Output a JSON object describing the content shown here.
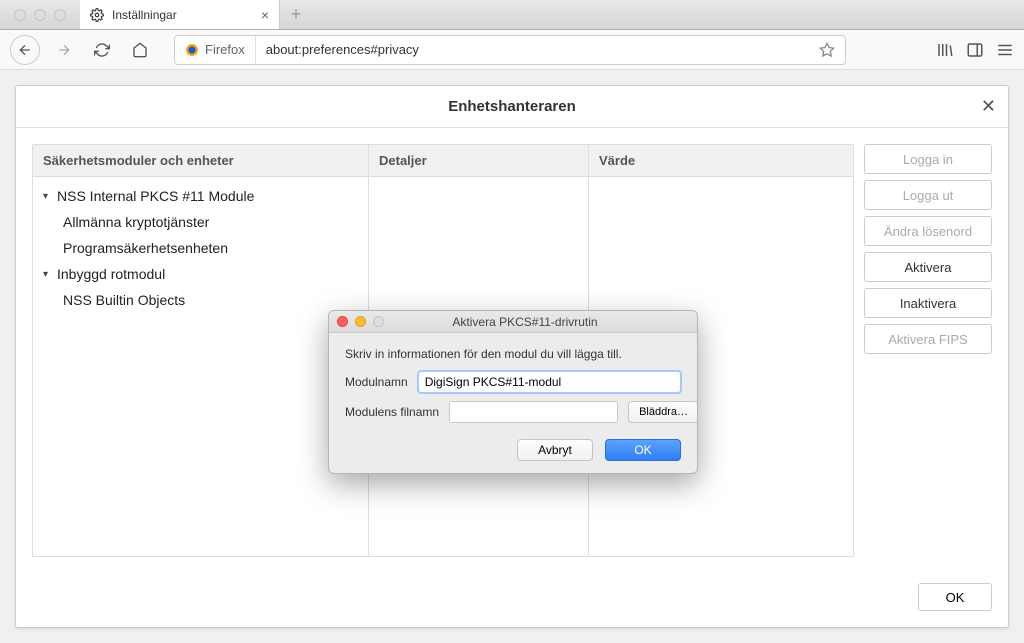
{
  "chrome": {
    "tab_title": "Inställningar",
    "identity_label": "Firefox",
    "url": "about:preferences#privacy"
  },
  "device_manager": {
    "title": "Enhetshanteraren",
    "col_modules_header": "Säkerhetsmoduler och enheter",
    "col_details_header": "Detaljer",
    "col_value_header": "Värde",
    "tree": {
      "module1": "NSS Internal PKCS #11 Module",
      "module1_child1": "Allmänna kryptotjänster",
      "module1_child2": "Programsäkerhetsenheten",
      "module2": "Inbyggd rotmodul",
      "module2_child1": "NSS Builtin Objects"
    },
    "buttons": {
      "login": "Logga in",
      "logout": "Logga ut",
      "change_pw": "Ändra lösenord",
      "load": "Aktivera",
      "unload": "Inaktivera",
      "fips": "Aktivera FIPS"
    },
    "ok": "OK"
  },
  "modal": {
    "title": "Aktivera PKCS#11-drivrutin",
    "instruction": "Skriv in informationen för den modul du vill lägga till.",
    "name_label": "Modulnamn",
    "name_value": "DigiSign PKCS#11-modul",
    "file_label": "Modulens filnamn",
    "file_value": "",
    "browse": "Bläddra…",
    "cancel": "Avbryt",
    "ok": "OK"
  }
}
